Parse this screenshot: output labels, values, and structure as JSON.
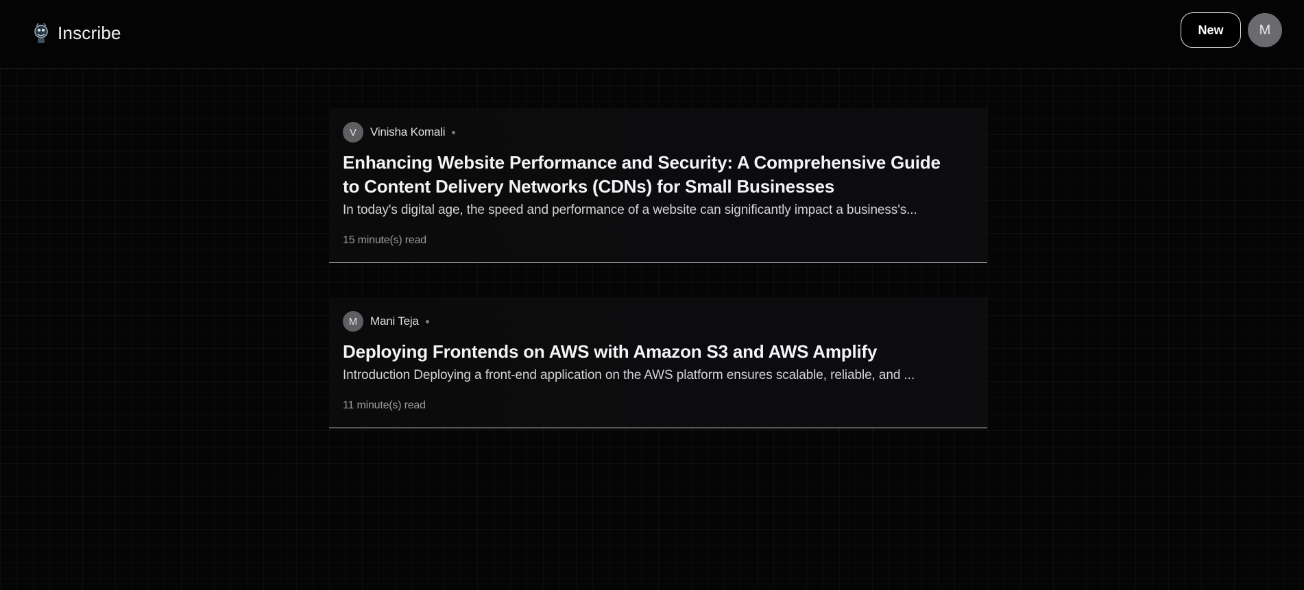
{
  "header": {
    "brand_name": "Inscribe",
    "new_label": "New",
    "user_initial": "M"
  },
  "posts": [
    {
      "author_initial": "V",
      "author": "Vinisha Komali",
      "title": "Enhancing Website Performance and Security: A Comprehensive Guide to Content Delivery Networks (CDNs) for Small Businesses",
      "excerpt": "In today's digital age, the speed and performance of a website can significantly impact a business's...",
      "read_time": "15 minute(s) read"
    },
    {
      "author_initial": "M",
      "author": "Mani Teja",
      "title": "Deploying Frontends on AWS with Amazon S3 and AWS Amplify",
      "excerpt": "Introduction Deploying a front-end application on the AWS platform ensures scalable, reliable, and ...",
      "read_time": "11 minute(s) read"
    }
  ]
}
